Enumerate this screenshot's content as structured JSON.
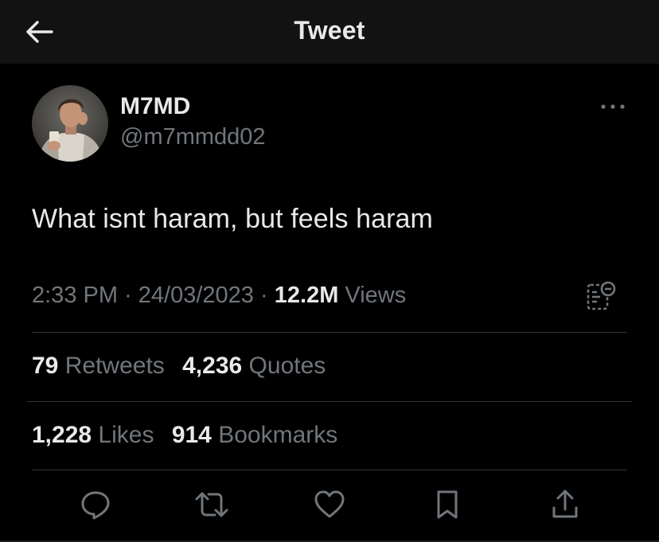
{
  "header": {
    "title": "Tweet",
    "back_icon": "arrow-left-icon"
  },
  "author": {
    "display_name": "M7MD",
    "handle": "@m7mmdd02",
    "more_icon": "more-horizontal-icon"
  },
  "tweet": {
    "text": "What isnt haram, but feels haram",
    "time": "2:33 PM",
    "separator": "·",
    "date": "24/03/2023",
    "views_count": "12.2M",
    "views_label": "Views",
    "analytics_icon": "analytics-icon"
  },
  "stats": {
    "retweets_count": "79",
    "retweets_label": "Retweets",
    "quotes_count": "4,236",
    "quotes_label": "Quotes",
    "likes_count": "1,228",
    "likes_label": "Likes",
    "bookmarks_count": "914",
    "bookmarks_label": "Bookmarks"
  },
  "actions": [
    {
      "name": "reply",
      "icon": "reply-icon"
    },
    {
      "name": "retweet",
      "icon": "retweet-icon"
    },
    {
      "name": "like",
      "icon": "heart-icon"
    },
    {
      "name": "bookmark",
      "icon": "bookmark-icon"
    },
    {
      "name": "share",
      "icon": "share-icon"
    }
  ],
  "colors": {
    "background": "#000000",
    "header_background": "#121212",
    "primary_text": "#e7e9ea",
    "secondary_text": "#71767b",
    "divider": "#2f3336"
  }
}
